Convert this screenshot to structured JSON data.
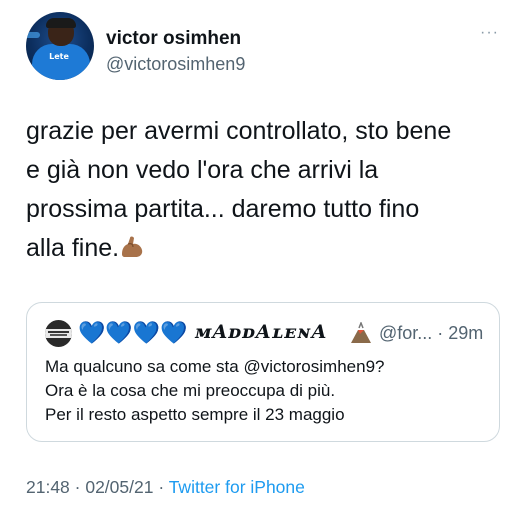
{
  "author": {
    "display_name": "victor osimhen",
    "handle": "@victorosimhen9",
    "avatar_shirt_text": "Lete"
  },
  "more_label": "···",
  "tweet": {
    "lines": [
      "grazie per avermi controllato, sto bene",
      "e già non vedo l'ora che arrivi la",
      "prossima partita... daremo tutto fino",
      "alla fine."
    ],
    "emoji": "flexed-biceps"
  },
  "quoted": {
    "hearts": "💙💙💙💙",
    "display_name": "ᴍAᴅᴅAʟᴇɴA",
    "handle_time": "@for... · 29m",
    "lines": [
      "Ma qualcuno sa come sta @victorosimhen9?",
      "Ora è la cosa che mi preoccupa di più.",
      "Per il resto aspetto sempre il 23 maggio"
    ]
  },
  "meta": {
    "timestamp": "21:48 · 02/05/21 · ",
    "source": "Twitter for iPhone"
  },
  "colors": {
    "text": "#0f1419",
    "secondary": "#536471",
    "link": "#1d9bf0",
    "border": "#cfd9de"
  }
}
